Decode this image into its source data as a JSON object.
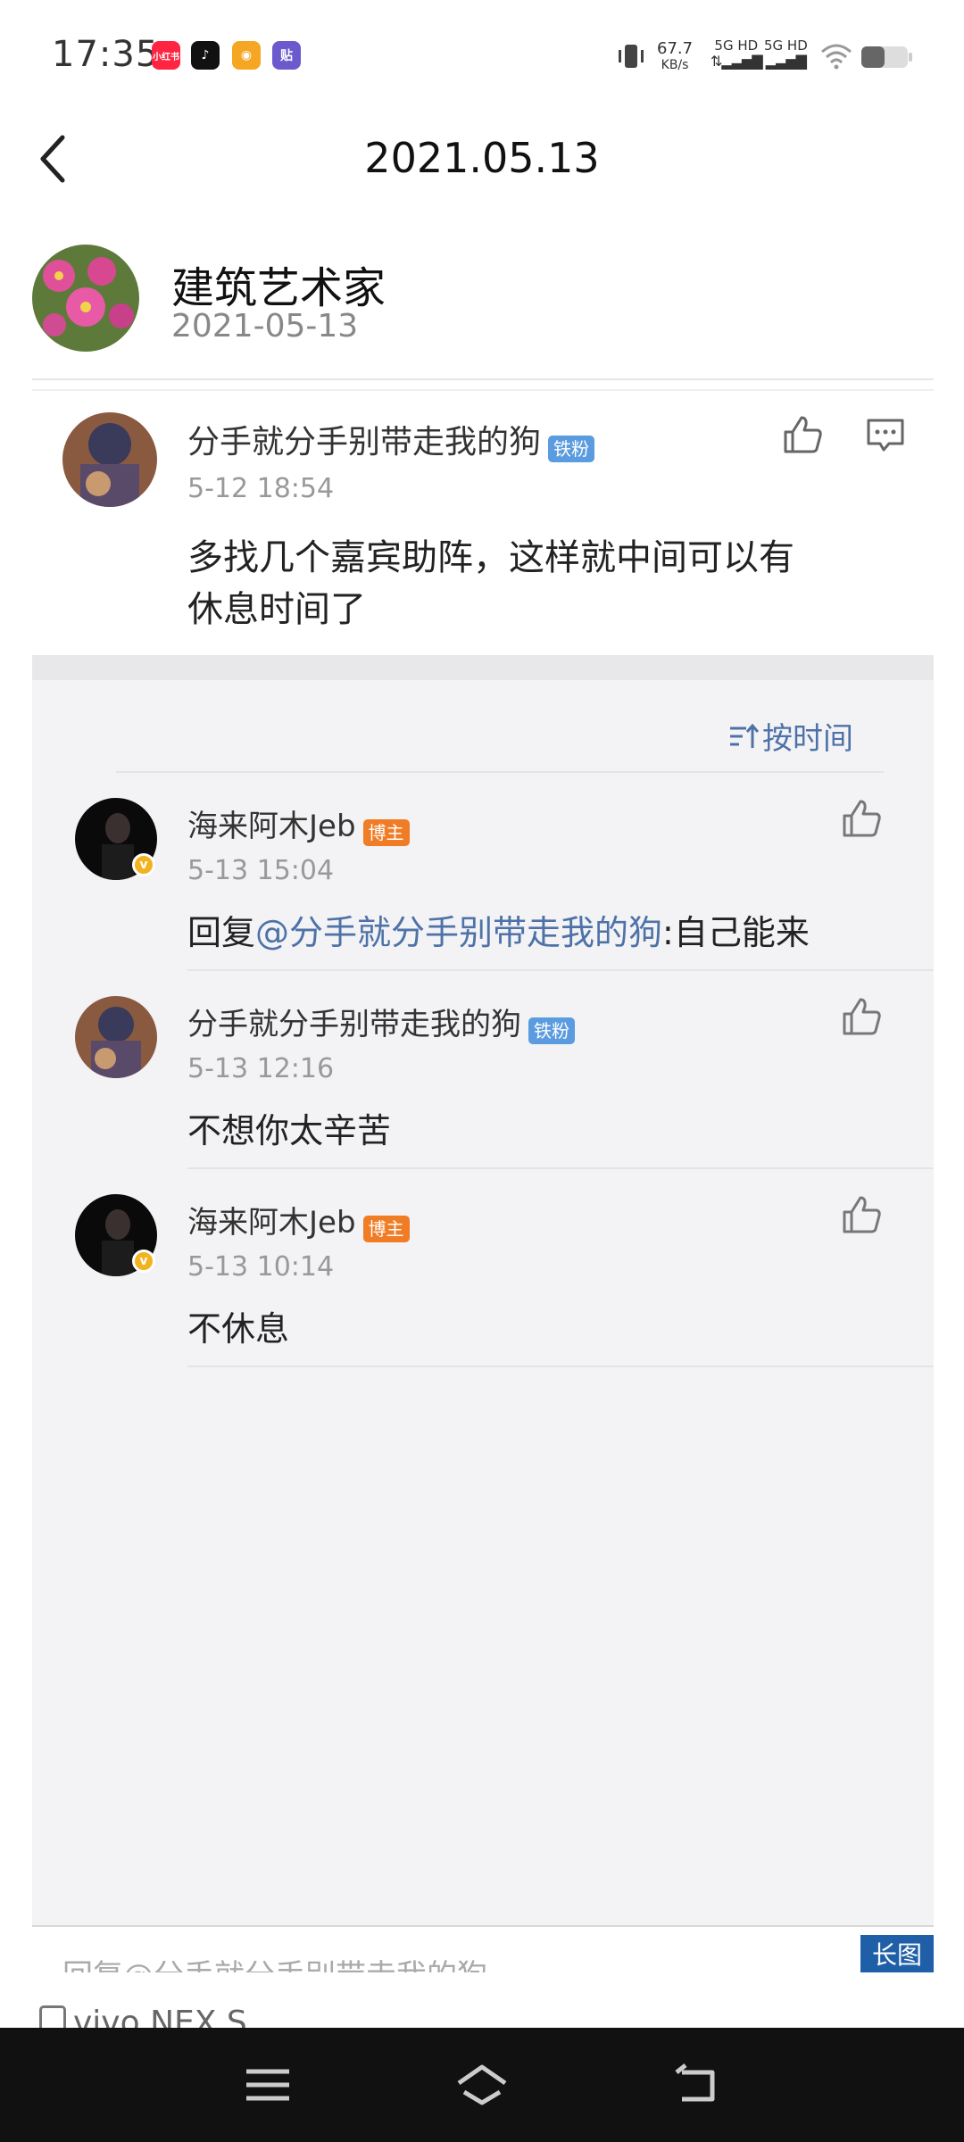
{
  "status_bar": {
    "time": "17:35",
    "apps": [
      {
        "icon": "xiaohongshu-icon",
        "label": "小红书",
        "color": "#ff2442"
      },
      {
        "icon": "douyin-icon",
        "label": "♪",
        "color": "#111111"
      },
      {
        "icon": "weibo-icon",
        "label": "◉",
        "color": "#f5a623"
      },
      {
        "icon": "tieba-icon",
        "label": "贴",
        "color": "#6a5acd"
      }
    ],
    "speed": "67.7",
    "speed_unit": "KB/s",
    "signal1": "5G HD",
    "signal2": "5G HD"
  },
  "header": {
    "title": "2021.05.13",
    "back_icon": "back-arrow-icon"
  },
  "post": {
    "author": "建筑艺术家",
    "date": "2021-05-13"
  },
  "main_comment": {
    "user": "分手就分手别带走我的狗",
    "badge": "铁粉",
    "time": "5-12 18:54",
    "text_line1": "多找几个嘉宾助阵，这样就中间可以有",
    "text_line2": "休息时间了"
  },
  "sort": {
    "label": "按时间",
    "icon": "sort-icon"
  },
  "replies": [
    {
      "user": "海来阿木Jeb",
      "badge": "博主",
      "time": "5-13 15:04",
      "text_prefix": "回复",
      "mention": "@分手就分手别带走我的狗",
      "text_suffix": ":自己能来"
    },
    {
      "user": "分手就分手别带走我的狗",
      "badge": "铁粉",
      "time": "5-13 12:16",
      "text": "不想你太辛苦"
    },
    {
      "user": "海来阿木Jeb",
      "badge": "博主",
      "time": "5-13 10:14",
      "text": "不休息"
    }
  ],
  "bottom": {
    "reply_placeholder": "回复@分手就分手别带走我的狗",
    "long_image": "长图",
    "device": "vivo NEX S"
  }
}
